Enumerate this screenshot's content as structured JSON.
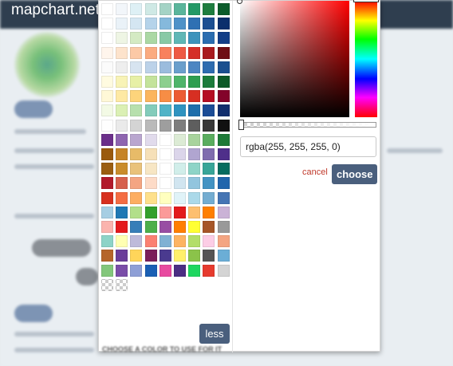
{
  "app": {
    "brand": "mapchart.net"
  },
  "picker": {
    "palette_rows": [
      [
        "#ffffff",
        "#f2f6fa",
        "#def0f5",
        "#cfe9e5",
        "#a4d3c5",
        "#5ab59b",
        "#249966",
        "#1e7d3f",
        "#0c5c2b"
      ],
      [
        "#ffffff",
        "#eaf2f8",
        "#d4e6f2",
        "#b5d3ea",
        "#85b9dc",
        "#4f92c8",
        "#2f70b3",
        "#1c4f92",
        "#0b2f6c"
      ],
      [
        "#ffffff",
        "#eef5e4",
        "#d4eac3",
        "#abd8a4",
        "#88c9a6",
        "#5fb7b6",
        "#3c93bc",
        "#2a6db0",
        "#123e87"
      ],
      [
        "#fff5ec",
        "#fde3cc",
        "#fcc9a6",
        "#fbab80",
        "#f8815d",
        "#ee5a44",
        "#d52f28",
        "#a91a1e",
        "#6e0e14"
      ],
      [
        "#fbfbfb",
        "#eeeeee",
        "#d7e4f0",
        "#bcd2e9",
        "#9bbcdd",
        "#6a9fcc",
        "#4d86c2",
        "#2e6cb0",
        "#1a4f8f"
      ],
      [
        "#fffbe0",
        "#f8f3b6",
        "#e7f0a5",
        "#c4e39b",
        "#8ccf8e",
        "#4fb56a",
        "#2e9e4f",
        "#1c7c3b",
        "#0d5a28"
      ],
      [
        "#fff8d7",
        "#fee9a4",
        "#fdd47b",
        "#fbb55d",
        "#f78d45",
        "#ec5c33",
        "#d72f22",
        "#b50d23",
        "#83032a"
      ],
      [
        "#f3fae5",
        "#dbf0b4",
        "#b7e0ad",
        "#83ccbb",
        "#50b3c7",
        "#2f93c0",
        "#1e6eab",
        "#1b4c96",
        "#112e6d"
      ],
      [
        "#fefefe",
        "#eaeaea",
        "#d4d4d4",
        "#bababa",
        "#9e9e9e",
        "#7d7d7d",
        "#5e5e5e",
        "#383838",
        "#111111"
      ],
      [
        "#6b2f8a",
        "#8e65b0",
        "#b9a6cf",
        "#e1dbec",
        "#ffffff",
        "#dcebd5",
        "#a8d39d",
        "#5aad5f",
        "#1e7a38"
      ],
      [
        "#9a5a0e",
        "#c68428",
        "#e7bb68",
        "#f6e0b8",
        "#ffffff",
        "#dbd5ea",
        "#b0a5d0",
        "#7f6cae",
        "#4f2f8a"
      ],
      [
        "#9b5e11",
        "#c98c2c",
        "#e9c27a",
        "#f7e6c4",
        "#ffffff",
        "#d1eeea",
        "#8ed4c7",
        "#38a598",
        "#066c5f"
      ],
      [
        "#b2192b",
        "#d6604d",
        "#f4a582",
        "#fddbc7",
        "#ffffff",
        "#d1e5f0",
        "#92c5de",
        "#4393c3",
        "#2166ac"
      ],
      [
        "#d7301f",
        "#f46d43",
        "#fdae61",
        "#fee08b",
        "#ffffbf",
        "#e0f3f8",
        "#abd9e9",
        "#74add1",
        "#4575b4"
      ],
      [
        "#a6cee3",
        "#1f78b4",
        "#b2df8a",
        "#33a02c",
        "#fb9a99",
        "#e31a1c",
        "#fdbf6f",
        "#ff7f00",
        "#cab2d6"
      ],
      [
        "#fbb4ae",
        "#e41a1c",
        "#377eb8",
        "#4daf4a",
        "#984ea3",
        "#ff7f00",
        "#ffff33",
        "#a65628",
        "#999999"
      ],
      [
        "#8dd3c7",
        "#ffffb3",
        "#bebada",
        "#fb8072",
        "#80b1d3",
        "#fdb462",
        "#b3de69",
        "#fccde5",
        "#f4a582"
      ],
      [
        "#b5652a",
        "#6a3d9a",
        "#ffd55a",
        "#7b1f5a",
        "#4a3a8f",
        "#fff06b",
        "#8bc34a",
        "#555555",
        "#6baed6"
      ],
      [
        "#83c77b",
        "#7a4da8",
        "#8e9fd6",
        "#1a5fb4",
        "#e84aa0",
        "#4b2e83",
        "#1ed760",
        "#e63b2e",
        "#d4d4d4"
      ]
    ],
    "transparent_swatches": 2,
    "color_value": "rgba(255, 255, 255, 0)",
    "cancel_label": "cancel",
    "choose_label": "choose",
    "less_label": "less",
    "hue_color": "#ff0000"
  },
  "background_text": {
    "bottom_partial": "CHOOSE A COLOR TO USE FOR IT"
  },
  "colors": {
    "topbar": "#2f3e4f",
    "button": "#4a5f7d",
    "cancel": "#c0392b"
  }
}
